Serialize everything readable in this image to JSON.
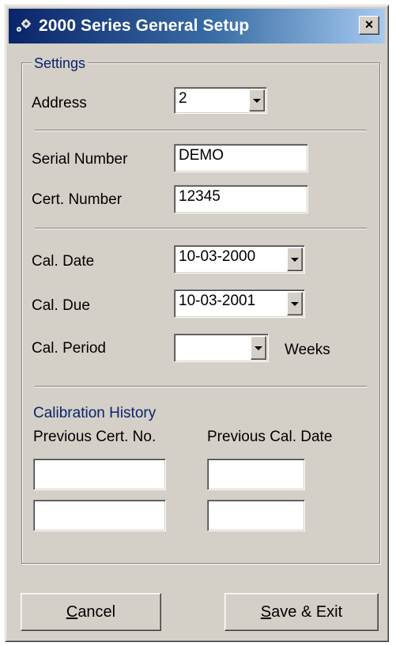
{
  "window": {
    "title": "2000 Series General Setup",
    "close_glyph": "×"
  },
  "settings": {
    "group_label": "Settings",
    "address_label": "Address",
    "address_value": "2"
  },
  "ids": {
    "serial_label": "Serial Number",
    "serial_value": "DEMO",
    "cert_label": "Cert. Number",
    "cert_value": "12345"
  },
  "calibration": {
    "date_label": "Cal. Date",
    "date_value": "10-03-2000",
    "due_label": "Cal. Due",
    "due_value": "10-03-2001",
    "period_label": "Cal. Period",
    "period_value": "",
    "period_unit": "Weeks"
  },
  "history": {
    "title": "Calibration History",
    "col_cert": "Previous Cert. No.",
    "col_date": "Previous Cal. Date",
    "rows": [
      {
        "cert": "",
        "date": ""
      },
      {
        "cert": "",
        "date": ""
      }
    ]
  },
  "buttons": {
    "cancel_mnemonic": "C",
    "cancel_rest": "ancel",
    "save_mnemonic": "S",
    "save_rest": "ave & Exit"
  },
  "colors": {
    "titlebar_start": "#0a246a",
    "titlebar_end": "#a6caf0",
    "face": "#d4d0c8",
    "group_text": "#0a246a"
  }
}
